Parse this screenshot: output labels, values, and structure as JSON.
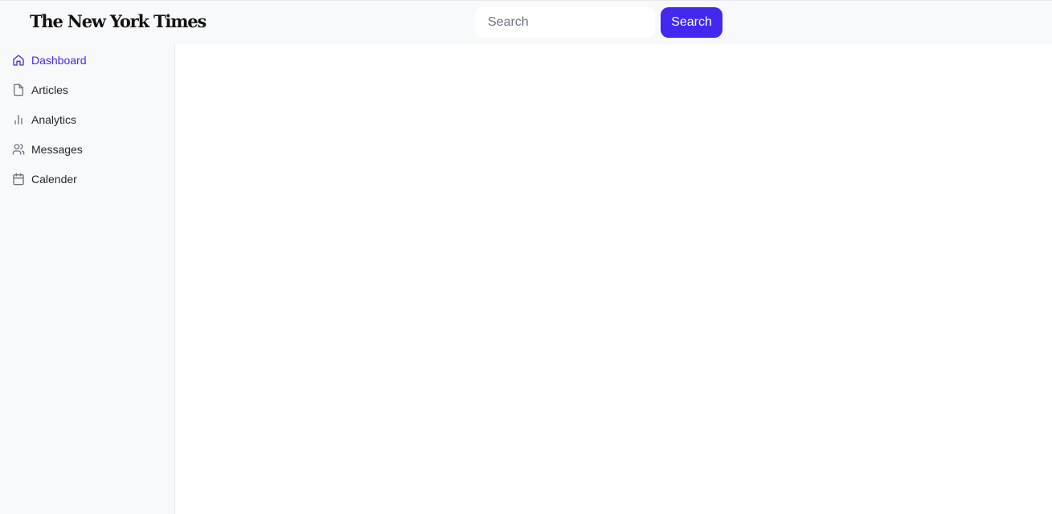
{
  "header": {
    "logo_text": "The New York Times",
    "search": {
      "placeholder": "Search",
      "value": ""
    },
    "search_button_label": "Search"
  },
  "sidebar": {
    "items": [
      {
        "label": "Dashboard",
        "icon": "home-icon",
        "active": true
      },
      {
        "label": "Articles",
        "icon": "file-icon",
        "active": false
      },
      {
        "label": "Analytics",
        "icon": "bar-chart-icon",
        "active": false
      },
      {
        "label": "Messages",
        "icon": "users-icon",
        "active": false
      },
      {
        "label": "Calender",
        "icon": "calendar-icon",
        "active": false
      }
    ]
  },
  "colors": {
    "accent": "#4328f0",
    "sidebar_bg": "#f8f9fb",
    "icon_gray": "#6b7280"
  }
}
